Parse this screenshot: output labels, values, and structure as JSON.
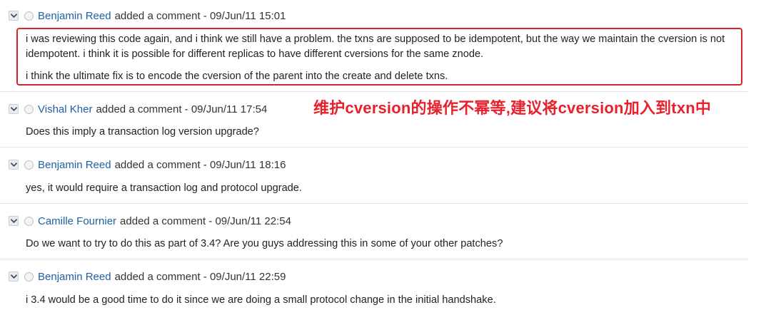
{
  "comments": [
    {
      "author": "Benjamin Reed",
      "meta": "added a comment - 09/Jun/11 15:01",
      "body": [
        "i was reviewing this code again, and i think we still have a problem. the txns are supposed to be idempotent, but the way we maintain the cversion is not idempotent. i think it is possible for different replicas to have different cversions for the same znode.",
        "i think the ultimate fix is to encode the cversion of the parent into the create and delete txns."
      ]
    },
    {
      "author": "Vishal Kher",
      "meta": "added a comment - 09/Jun/11 17:54",
      "body": [
        "Does this imply a transaction log version upgrade?"
      ]
    },
    {
      "author": "Benjamin Reed",
      "meta": "added a comment - 09/Jun/11 18:16",
      "body": [
        "yes, it would require a transaction log and protocol upgrade."
      ]
    },
    {
      "author": "Camille Fournier",
      "meta": "added a comment - 09/Jun/11 22:54",
      "body": [
        "Do we want to try to do this as part of 3.4? Are you guys addressing this in some of your other patches?"
      ]
    },
    {
      "author": "Benjamin Reed",
      "meta": "added a comment - 09/Jun/11 22:59",
      "body": [
        "i 3.4 would be a good time to do it since we are doing a small protocol change in the initial handshake."
      ]
    }
  ],
  "annotation": "维护cversion的操作不幂等,建议将cversion加入到txn中",
  "colors": {
    "author_link": "#1f5fa8",
    "highlight": "#d8222c",
    "annotation": "#e8202c"
  },
  "icons": {
    "toggle": "chevron-down-icon",
    "avatar": "user-avatar-icon"
  }
}
